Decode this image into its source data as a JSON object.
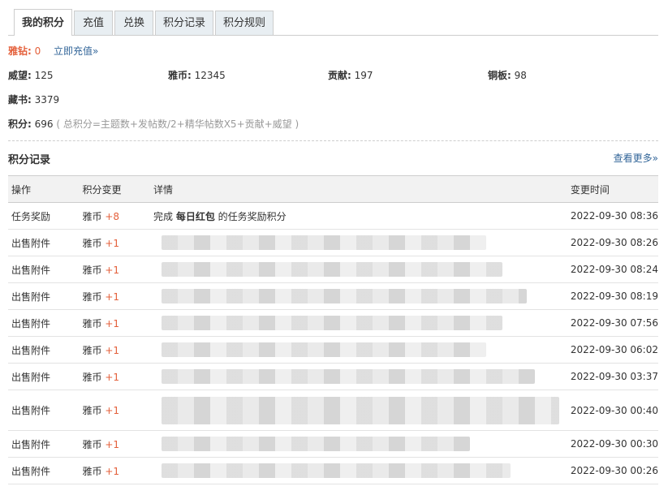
{
  "tabs": [
    {
      "label": "我的积分",
      "active": true
    },
    {
      "label": "充值",
      "active": false
    },
    {
      "label": "兑换",
      "active": false
    },
    {
      "label": "积分记录",
      "active": false
    },
    {
      "label": "积分规则",
      "active": false
    }
  ],
  "summary": {
    "diamond_label": "雅钻:",
    "diamond_value": "0",
    "recharge_link": "立即充值»",
    "stats": [
      {
        "label": "威望:",
        "value": "125"
      },
      {
        "label": "雅币:",
        "value": "12345"
      },
      {
        "label": "贡献:",
        "value": "197"
      },
      {
        "label": "铜板:",
        "value": "98"
      }
    ],
    "books_label": "藏书:",
    "books_value": "3379",
    "score_label": "积分:",
    "score_value": "696",
    "score_formula": "( 总积分=主题数+发帖数/2+精华帖数X5+贡献+威望 )"
  },
  "records": {
    "title": "积分记录",
    "more_link": "查看更多»",
    "headers": [
      "操作",
      "积分变更",
      "详情",
      "变更时间"
    ],
    "rows": [
      {
        "op": "任务奖励",
        "currency": "雅币",
        "change": "+8",
        "detail_prefix": "完成",
        "detail_bold": "每日红包",
        "detail_suffix": "的任务奖励积分",
        "time": "2022-09-30 08:36"
      },
      {
        "op": "出售附件",
        "currency": "雅币",
        "change": "+1",
        "time": "2022-09-30 08:26"
      },
      {
        "op": "出售附件",
        "currency": "雅币",
        "change": "+1",
        "time": "2022-09-30 08:24"
      },
      {
        "op": "出售附件",
        "currency": "雅币",
        "change": "+1",
        "time": "2022-09-30 08:19"
      },
      {
        "op": "出售附件",
        "currency": "雅币",
        "change": "+1",
        "time": "2022-09-30 07:56"
      },
      {
        "op": "出售附件",
        "currency": "雅币",
        "change": "+1",
        "time": "2022-09-30 06:02"
      },
      {
        "op": "出售附件",
        "currency": "雅币",
        "change": "+1",
        "time": "2022-09-30 03:37"
      },
      {
        "op": "出售附件",
        "currency": "雅币",
        "change": "+1",
        "time": "2022-09-30 00:40"
      },
      {
        "op": "出售附件",
        "currency": "雅币",
        "change": "+1",
        "time": "2022-09-30 00:30"
      },
      {
        "op": "出售附件",
        "currency": "雅币",
        "change": "+1",
        "time": "2022-09-30 00:26"
      }
    ]
  }
}
